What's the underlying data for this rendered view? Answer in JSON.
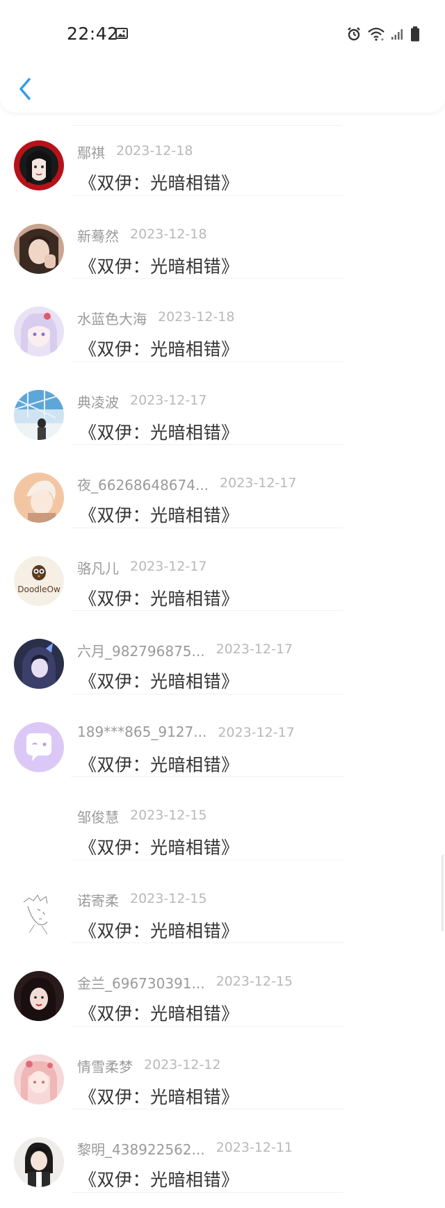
{
  "status_bar": {
    "time": "22:42",
    "icons": [
      "image-icon",
      "alarm-icon",
      "wifi-icon",
      "signal-icon",
      "battery-icon"
    ]
  },
  "header": {
    "back_icon": "chevron-left-icon",
    "accent": "#2d9bf0"
  },
  "list": {
    "items": [
      {
        "name": "鄢祺",
        "date": "2023-12-18",
        "book": "《双伊：光暗相错》",
        "avatar": "avatar-1"
      },
      {
        "name": "新蓦然",
        "date": "2023-12-18",
        "book": "《双伊：光暗相错》",
        "avatar": "avatar-2"
      },
      {
        "name": "水蓝色大海",
        "date": "2023-12-18",
        "book": "《双伊：光暗相错》",
        "avatar": "avatar-3"
      },
      {
        "name": "典凌波",
        "date": "2023-12-17",
        "book": "《双伊：光暗相错》",
        "avatar": "avatar-4"
      },
      {
        "name": "夜_66268648674...",
        "date": "2023-12-17",
        "book": "《双伊：光暗相错》",
        "avatar": "avatar-5"
      },
      {
        "name": "骆凡儿",
        "date": "2023-12-17",
        "book": "《双伊：光暗相错》",
        "avatar": "avatar-6"
      },
      {
        "name": "六月_982796875...",
        "date": "2023-12-17",
        "book": "《双伊：光暗相错》",
        "avatar": "avatar-7"
      },
      {
        "name": "189***865_9127...",
        "date": "2023-12-17",
        "book": "《双伊：光暗相错》",
        "avatar": "avatar-8"
      },
      {
        "name": "邹俊慧",
        "date": "2023-12-15",
        "book": "《双伊：光暗相错》",
        "avatar": "avatar-9"
      },
      {
        "name": "诺寄柔",
        "date": "2023-12-15",
        "book": "《双伊：光暗相错》",
        "avatar": "avatar-10"
      },
      {
        "name": "金兰_696730391...",
        "date": "2023-12-15",
        "book": "《双伊：光暗相错》",
        "avatar": "avatar-11"
      },
      {
        "name": "情雪柔梦",
        "date": "2023-12-12",
        "book": "《双伊：光暗相错》",
        "avatar": "avatar-12"
      },
      {
        "name": "黎明_438922562...",
        "date": "2023-12-11",
        "book": "《双伊：光暗相错》",
        "avatar": "avatar-13"
      }
    ]
  },
  "avatar_logo_text": "DoodleOw"
}
